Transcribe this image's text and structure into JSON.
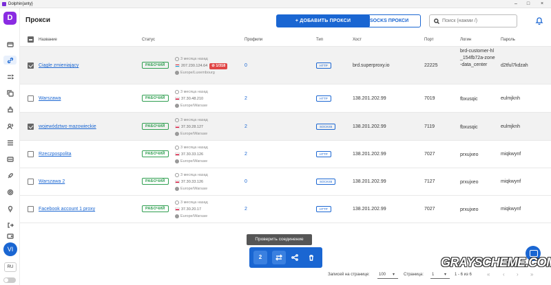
{
  "window": {
    "title": "Dolphin{anty}",
    "minimize": "–",
    "maximize": "□",
    "close": "×"
  },
  "sidebar": {
    "logo": "D",
    "avatar": "VI",
    "language": "RU"
  },
  "header": {
    "title": "Прокси",
    "add_button": "+ ДОБАВИТЬ ПРОКСИ",
    "asocks_button": "ASOCKS ПРОКСИ",
    "search_placeholder": "Поиск (нажми /)"
  },
  "table": {
    "columns": {
      "name": "Название",
      "status": "Статус",
      "profiles": "Профили",
      "type": "Тип",
      "host": "Хост",
      "port": "Порт",
      "login": "Логин",
      "password": "Пароль"
    },
    "rows": [
      {
        "name": "Ciągle zmieniający",
        "status": "РАБОЧИЙ",
        "checked_ago": "3 месяца назад",
        "ip": "207.230.124.64",
        "flag": "lu",
        "location": "Europe/Luxembourg",
        "rotate_badge": "1/318",
        "profiles": "0",
        "type": "HTTP",
        "host": "brd.superproxy.io",
        "port": "22225",
        "login": "brd-customer-hl_154fb72a-zone-data_center",
        "password": "d2tful7kdzah",
        "selected": true
      },
      {
        "name": "Warszawa",
        "status": "РАБОЧИЙ",
        "checked_ago": "3 месяца назад",
        "ip": "37.30.48.210",
        "flag": "pl",
        "location": "Europe/Warsaw",
        "profiles": "2",
        "type": "HTTP",
        "host": "138.201.202.99",
        "port": "7019",
        "login": "fbxusqic",
        "password": "eulmjknh",
        "selected": false
      },
      {
        "name": "województwo mazowieckie",
        "status": "РАБОЧИЙ",
        "checked_ago": "3 месяца назад",
        "ip": "37.30.28.127",
        "flag": "pl",
        "location": "Europe/Warsaw",
        "profiles": "2",
        "type": "SOCKS5",
        "host": "138.201.202.99",
        "port": "7119",
        "login": "fbxusqic",
        "password": "eulmjknh",
        "selected": true
      },
      {
        "name": "Rzeczpospolita",
        "status": "РАБОЧИЙ",
        "checked_ago": "3 месяца назад",
        "ip": "37.30.33.126",
        "flag": "pl",
        "location": "Europe/Warsaw",
        "profiles": "2",
        "type": "HTTP",
        "host": "138.201.202.99",
        "port": "7027",
        "login": "prxujxeo",
        "password": "miqkwynf",
        "selected": false
      },
      {
        "name": "Warszawa 2",
        "status": "РАБОЧИЙ",
        "checked_ago": "3 месяца назад",
        "ip": "37.30.33.126",
        "flag": "pl",
        "location": "Europe/Warsaw",
        "profiles": "0",
        "type": "SOCKS5",
        "host": "138.201.202.99",
        "port": "7127",
        "login": "prxujxeo",
        "password": "miqkwynf",
        "selected": false
      },
      {
        "name": "Facebook account 1 proxy",
        "status": "РАБОЧИЙ",
        "checked_ago": "3 месяца назад",
        "ip": "37.30.20.17",
        "flag": "pl",
        "location": "Europe/Warsaw",
        "profiles": "2",
        "type": "HTTP",
        "host": "138.201.202.99",
        "port": "7027",
        "login": "prxujxeo",
        "password": "miqkwynf",
        "selected": false
      }
    ]
  },
  "action_bar": {
    "tooltip": "Проверить соединение",
    "selected_count": "2"
  },
  "pagination": {
    "per_page_label": "Записей на странице:",
    "per_page": "100",
    "page_label": "Страница:",
    "page": "1",
    "range": "1 - 6 из 6"
  },
  "watermark": "GRAYSCHEME.COM",
  "colors": {
    "accent": "#1a66d2",
    "brand": "#8a2be2",
    "status_ok": "#2e9e4f",
    "badge_red": "#e04646"
  }
}
